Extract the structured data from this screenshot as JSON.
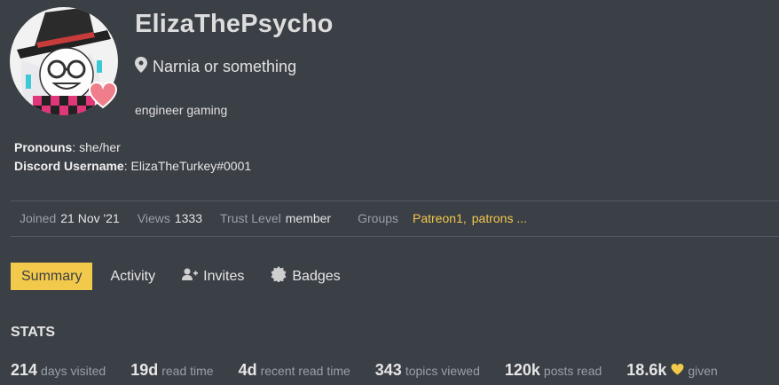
{
  "profile": {
    "username": "ElizaThePsycho",
    "location": "Narnia or something",
    "bio": "engineer gaming"
  },
  "fields": {
    "pronouns_label": "Pronouns",
    "pronouns_value": "she/her",
    "discord_label": "Discord Username",
    "discord_value": "ElizaTheTurkey#0001"
  },
  "meta": {
    "joined_label": "Joined",
    "joined_value": "21 Nov '21",
    "views_label": "Views",
    "views_value": "1333",
    "trust_label": "Trust Level",
    "trust_value": "member",
    "groups_label": "Groups",
    "groups": [
      "Patreon1,",
      "patrons ..."
    ]
  },
  "tabs": [
    {
      "label": "Summary",
      "active": true
    },
    {
      "label": "Activity"
    },
    {
      "label": "Invites",
      "icon": "user-plus-icon"
    },
    {
      "label": "Badges",
      "icon": "badge-icon"
    }
  ],
  "stats": {
    "heading": "STATS",
    "items": [
      {
        "value": "214",
        "label": "days visited"
      },
      {
        "value": "19d",
        "label": "read time"
      },
      {
        "value": "4d",
        "label": "recent read time"
      },
      {
        "value": "343",
        "label": "topics viewed"
      },
      {
        "value": "120k",
        "label": "posts read"
      },
      {
        "value": "18.6k",
        "label": "given",
        "icon": "heart-icon"
      }
    ]
  },
  "colors": {
    "background": "#3b3f46",
    "accent": "#f3c94b",
    "muted": "#9aa0a8"
  }
}
